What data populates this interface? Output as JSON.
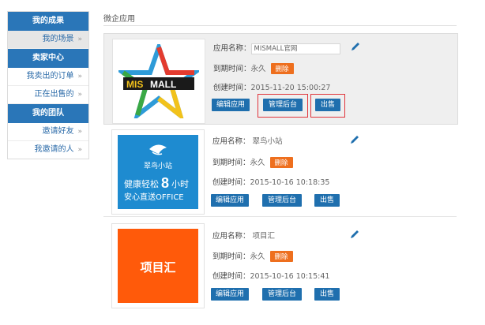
{
  "sidebar": {
    "sections": [
      {
        "header": "我的成果",
        "items": [
          {
            "label": "我的场景",
            "active": true
          }
        ]
      },
      {
        "header": "卖家中心",
        "items": [
          {
            "label": "我卖出的订单",
            "active": false
          },
          {
            "label": "正在出售的",
            "active": false
          }
        ]
      },
      {
        "header": "我的团队",
        "items": [
          {
            "label": "邀请好友",
            "active": false
          },
          {
            "label": "我邀请的人",
            "active": false
          }
        ]
      }
    ],
    "chevron": "»"
  },
  "main": {
    "title": "微企应用",
    "labels": {
      "name": "应用名称：",
      "expiry": "到期时间：",
      "created": "创建时间："
    },
    "buttons": {
      "edit": "编辑应用",
      "admin": "管理后台",
      "sell": "出售",
      "delete": "删除"
    },
    "apps": [
      {
        "name": "MISMALL官网",
        "expiry": "永久",
        "created": "2015-11-20 15:00:27",
        "logo_text": "MALL",
        "logo_prefix": "MIS"
      },
      {
        "name": "翠鸟小站",
        "expiry": "永久",
        "created": "2015-10-16 10:18:35",
        "logo_title": "翠鸟小站",
        "logo_line1a": "健康轻松",
        "logo_line1b": "8",
        "logo_line1c": "小时",
        "logo_line2": "安心直送OFFICE"
      },
      {
        "name": "项目汇",
        "expiry": "永久",
        "created": "2015-10-16 10:15:41",
        "logo_text": "项目汇"
      }
    ]
  },
  "colors": {
    "accent": "#2a76b8",
    "button": "#1f6fae",
    "delete": "#ee6f1e",
    "highlight": "#e0343b",
    "logo2_bg": "#1e8bd0",
    "logo3_bg": "#ff5a0a"
  },
  "icons": [
    "pencil-icon",
    "chevron-right-icon"
  ]
}
